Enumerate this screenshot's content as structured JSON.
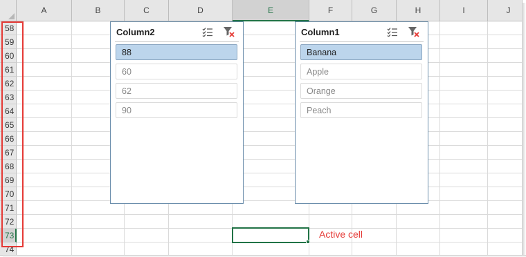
{
  "columns": [
    "A",
    "B",
    "C",
    "D",
    "E",
    "F",
    "G",
    "H",
    "I",
    "J"
  ],
  "selected_column": "E",
  "rows": [
    "58",
    "59",
    "60",
    "61",
    "62",
    "63",
    "64",
    "65",
    "66",
    "67",
    "68",
    "69",
    "70",
    "71",
    "72",
    "73",
    "74"
  ],
  "selected_row": "73",
  "slicers": [
    {
      "title": "Column2",
      "icons": [
        "multi-select-icon",
        "clear-filter-icon"
      ],
      "items": [
        {
          "label": "88",
          "selected": true
        },
        {
          "label": "60",
          "selected": false
        },
        {
          "label": "62",
          "selected": false
        },
        {
          "label": "90",
          "selected": false
        }
      ]
    },
    {
      "title": "Column1",
      "icons": [
        "multi-select-icon",
        "clear-filter-icon"
      ],
      "items": [
        {
          "label": "Banana",
          "selected": true
        },
        {
          "label": "Apple",
          "selected": false
        },
        {
          "label": "Orange",
          "selected": false
        },
        {
          "label": "Peach",
          "selected": false
        }
      ]
    }
  ],
  "annotation": "Active cell",
  "colors": {
    "accent_green": "#217346",
    "highlight_red": "#e53935",
    "slicer_selected": "#bcd5ec",
    "slicer_border": "#6a8dab"
  }
}
